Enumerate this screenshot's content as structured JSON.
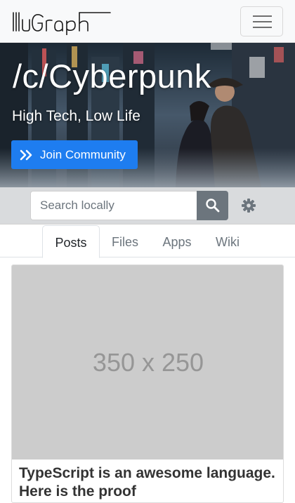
{
  "navbar": {
    "brand": "lllvGraph",
    "menu_icon": "hamburger-menu-icon"
  },
  "hero": {
    "title": "/c/Cyberpunk",
    "subtitle": "High Tech, Low Life",
    "join_label": "Join Community",
    "join_icon": "double-chevron-right-icon"
  },
  "search": {
    "placeholder": "Search locally",
    "search_icon": "search-icon",
    "settings_icon": "gear-icon"
  },
  "tabs": [
    {
      "label": "Posts",
      "active": true
    },
    {
      "label": "Files",
      "active": false
    },
    {
      "label": "Apps",
      "active": false
    },
    {
      "label": "Wiki",
      "active": false
    }
  ],
  "post": {
    "image_placeholder": "350 x 250",
    "title": "TypeScript is an awesome language. Here is the proof"
  },
  "colors": {
    "primary": "#1e7df0",
    "secondary": "#6c757d",
    "navbar_bg": "#f8f9fa",
    "placeholder_bg": "#cccccc"
  }
}
